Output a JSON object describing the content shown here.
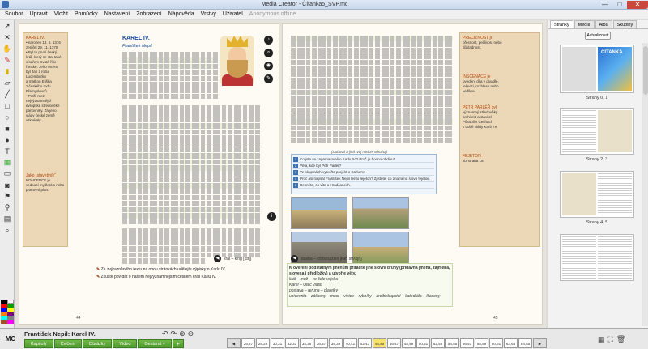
{
  "window": {
    "title": "Media Creator - Čítanka5_SVP.mc",
    "min": "—",
    "max": "□",
    "close": "✕"
  },
  "menu": {
    "items": [
      "Soubor",
      "Upravit",
      "Vložit",
      "Pomůcky",
      "Nastavení",
      "Zobrazení",
      "Nápověda",
      "Vrstvy",
      "Uživatel"
    ],
    "user_status": "Anonymous offline"
  },
  "tools": [
    "cursor-icon",
    "pointer-icon",
    "hand-icon",
    "pencil-icon",
    "marker-icon",
    "eraser-icon",
    "line-icon",
    "rect-icon",
    "ellipse-icon",
    "fill-rect-icon",
    "fill-ellipse-icon",
    "text-icon",
    "highlight-icon",
    "screen-icon",
    "camera-icon",
    "stamp-icon",
    "pin-icon",
    "reveal-icon",
    "zoom-icon"
  ],
  "colors": [
    "#000000",
    "#ffffff",
    "#ff0000",
    "#00a000",
    "#0000ff",
    "#ffff00",
    "#ff8000",
    "#800080",
    "#00ffff",
    "#808080",
    "#a05020",
    "#ff00ff"
  ],
  "left_page": {
    "sidebox": {
      "k1": "KAREL IV.",
      "l1": "• narozen 14. 5. 1316",
      "l2": "zemřel 29. 11. 1378",
      "l3": "• Byl to první český",
      "l4": "král, který se stal také",
      "l5": "císařem Svaté říše",
      "l6": "římské. Jeho otcem",
      "l7": "byl Jan z rodu",
      "l8": "Lucemburků",
      "l9": "a matkou Eliška",
      "l10": "z českého rodu",
      "l11": "Přemyslovců.",
      "l12": "• Patřil mezi",
      "l13": "nejvýznamnější",
      "l14": "evropské středověké",
      "l15": "panovníky. Za jeho",
      "l16": "vlády české země",
      "l17": "vzkvétaly.",
      "k2": "Jako „stavebník“",
      "l18": "KONCEPCE je",
      "l19": "vedoucí myšlenka nebo",
      "l20": "pracovní plán."
    },
    "title": "KAREL IV.",
    "subtitle": "František Nepil",
    "audio_label": "král – king [kɪŋ]",
    "page_number": "44"
  },
  "right_page": {
    "tasks": [
      "Co jste se zapamatovali o Karlu IV.? Proč je hodno obdivu?",
      "Věta, kde byl Petr Parléř?",
      "Ve skupinách vytvořte projekt o Karlu IV.",
      "Proč asi napsal František Nepil tento fejeton? Zjistěte, co znamená slovo fejeton.",
      "Řekněte, co víte o Hradčanech."
    ],
    "sidebox": {
      "k1": "PRECIZNOST je",
      "l1": "přesnost, pečlivost nebo",
      "l2": "důkladnost.",
      "k2": "INSCENACE je",
      "l3": "uvedení díla v divadle,",
      "l4": "televizi, rozhlase nebo",
      "l5": "ve filmu.",
      "k3": "PETR PARLÉŘ byl",
      "l6": "významný středověký",
      "l7": "architekt a stavitel.",
      "l8": "Působil v Čechách",
      "l9": "v době vlády Karla IV.",
      "k4": "FEJETON",
      "l10": "viz strana 18!"
    },
    "caption": "(Dobová a jiná tvůj nadpis sdružuj)",
    "audio_label": "stavba – construction [kənˈstrʌkʃn]",
    "page_number": "45"
  },
  "bottom_tasks": {
    "t1": "Ze zvýrazněného textu na obou stránkách udělejte výpisky o Karlu IV.",
    "t2": "Zkuste povídat o našem nejvýznamnějším českém králi Karlu IV.",
    "wl_title": "K ověření podstatným jménům přiřaďte jiné slovní druhy (přídavná jména, zájmena, slovesa i předložky) a utvořte věty.",
    "wl1": "král – muž – ve čele vojska",
    "wl2": "Karel – Otec vlasti",
    "wl3": "postava – reruna – platejky",
    "wl4": "univerzita – záškony – most – vinice – rybníky – arcibiskupství – katedrála – kłasony"
  },
  "right_panel": {
    "tabs": [
      "Stránky",
      "Média",
      "Alba",
      "Skupiny"
    ],
    "refresh_label": "Aktualizovat",
    "cover_title": "ČÍTANKA",
    "thumbs": [
      "Strany 0, 1",
      "Strany 2, 3",
      "Strany 4, 5"
    ]
  },
  "bottom_bar": {
    "logo": "MC",
    "chapter_title": "František Nepil: Karel IV.",
    "nav_buttons": [
      "Kapitoly",
      "Cvičení",
      "Obrázky",
      "Video",
      "Gestarat ▾",
      "+"
    ],
    "pages": [
      "26,27",
      "28,29",
      "30,31",
      "32,33",
      "34,35",
      "36,37",
      "38,39",
      "40,41",
      "42,43",
      "44,45",
      "46,47",
      "48,49",
      "50,51",
      "52,53",
      "54,55",
      "56,57",
      "58,59",
      "60,61",
      "62,63",
      "64,65"
    ],
    "current_page": "44,45"
  }
}
